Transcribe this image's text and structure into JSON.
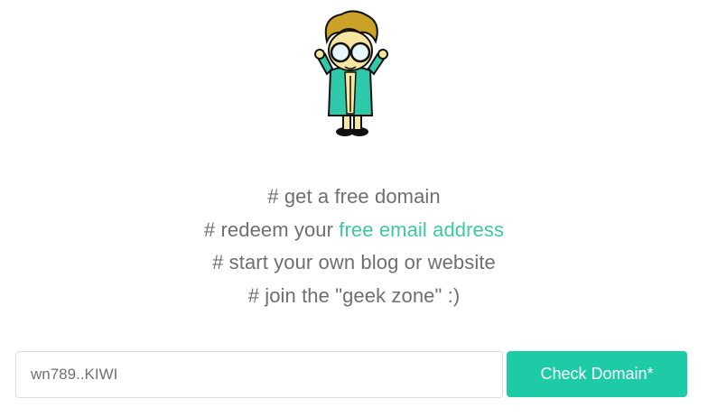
{
  "mascot": {
    "icon": "geek-mascot-icon"
  },
  "taglines": {
    "line1": "# get a free domain",
    "line2_prefix": "# redeem your ",
    "line2_link": "free email address",
    "line3": "# start your own blog or website",
    "line4": "# join the \"geek zone\" :)"
  },
  "search": {
    "value": "wn789..KIWI",
    "button_label": "Check Domain*"
  },
  "colors": {
    "accent": "#1dcca7",
    "link": "#3cc8a5",
    "text": "#6f6f6f"
  }
}
